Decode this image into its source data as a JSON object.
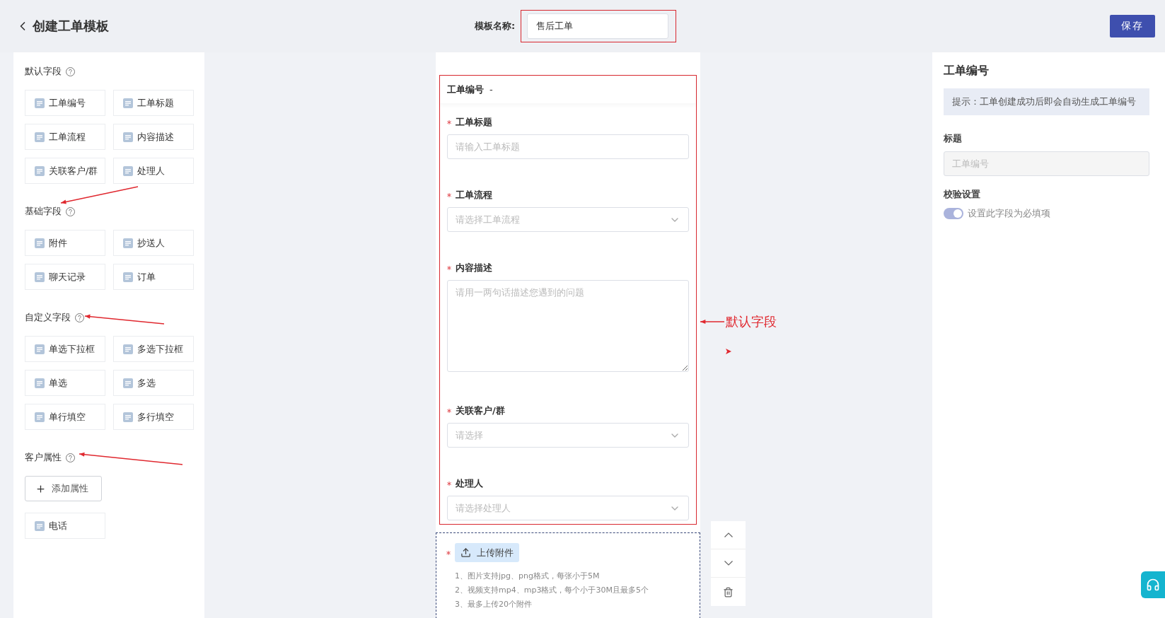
{
  "header": {
    "title": "创建工单模板",
    "template_name_label": "模板名称:",
    "template_name": "售后工单",
    "template_name_highlighted": true,
    "save_button": "保存"
  },
  "palette": {
    "sections": [
      {
        "title": "默认字段",
        "items": [
          "工单编号",
          "工单标题",
          "工单流程",
          "内容描述",
          "关联客户/群",
          "处理人"
        ]
      },
      {
        "title": "基础字段",
        "items": [
          "附件",
          "抄送人",
          "聊天记录",
          "订单"
        ]
      },
      {
        "title": "自定义字段",
        "items": [
          "单选下拉框",
          "多选下拉框",
          "单选",
          "多选",
          "单行填空",
          "多行填空"
        ]
      },
      {
        "title": "客户属性",
        "add_button": "添加属性",
        "items": [
          "电话"
        ]
      }
    ]
  },
  "form": {
    "default_group": {
      "highlighted": true,
      "number_label": "工单编号",
      "number_value": "-",
      "fields": [
        {
          "label": "工单标题",
          "required": true,
          "kind": "input",
          "placeholder": "请输入工单标题"
        },
        {
          "label": "工单流程",
          "required": true,
          "kind": "select",
          "placeholder": "请选择工单流程"
        },
        {
          "label": "内容描述",
          "required": true,
          "kind": "textarea",
          "placeholder": "请用一两句话描述您遇到的问题"
        },
        {
          "label": "关联客户/群",
          "required": true,
          "kind": "select",
          "placeholder": "请选择"
        },
        {
          "label": "处理人",
          "required": true,
          "kind": "select",
          "placeholder": "请选择处理人"
        }
      ]
    },
    "upload": {
      "selected": true,
      "required": true,
      "button": "上传附件",
      "notes": [
        "1、图片支持jpg、png格式，每张小于5M",
        "2、视频支持mp4、mp3格式，每个小于30M且最多5个",
        "3、最多上传20个附件"
      ]
    }
  },
  "properties": {
    "title": "工单编号",
    "hint": "提示：工单创建成功后即会自动生成工单编号",
    "title_label": "标题",
    "title_value": "工单编号",
    "title_disabled": true,
    "validation_label": "校验设置",
    "required_toggle": {
      "label": "设置此字段为必填项",
      "on": true,
      "disabled": true
    }
  },
  "annotations": [
    {
      "text": "默认字段"
    }
  ]
}
